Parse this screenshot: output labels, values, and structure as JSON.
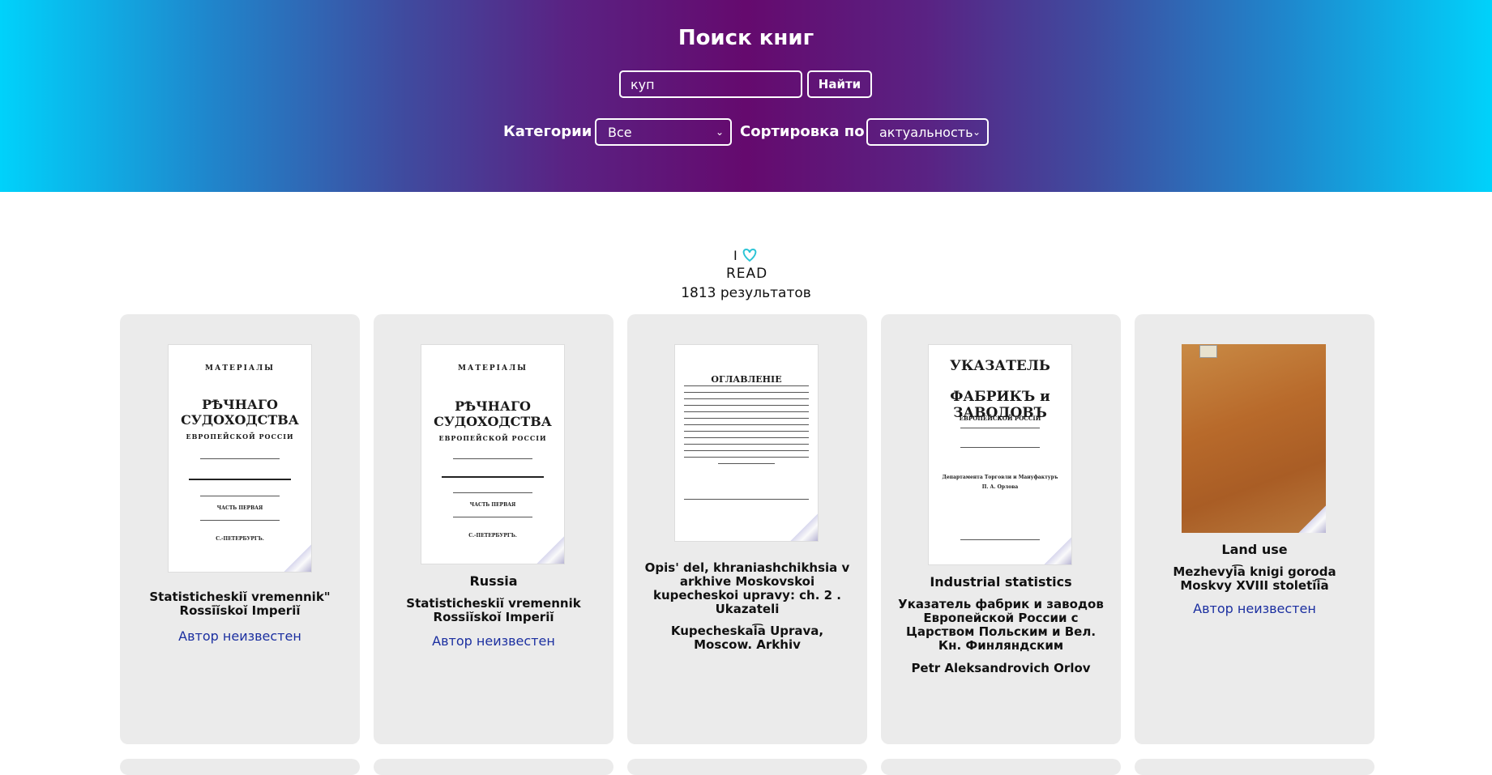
{
  "header": {
    "title": "Поиск книг",
    "search": {
      "value": "куп",
      "button_label": "Найти"
    },
    "filters": {
      "category_label": "Категории",
      "category_value": "Все",
      "sort_label": "Сортировка по",
      "sort_value": "актуальность"
    }
  },
  "logo": {
    "line1": "I",
    "line2": "READ",
    "heart_color": "#2bc4d6"
  },
  "results": {
    "count_text": "1813 результатов"
  },
  "books": [
    {
      "category": "",
      "title": "Statisticheskiĭ vremennik\" Rossīĭskoĭ Imperiĭ",
      "author": "Автор неизвестен",
      "author_is_link": true
    },
    {
      "category": "Russia",
      "title": "Statisticheskiĭ vremennik Rossiĭskoĭ Imperiĭ",
      "author": "Автор неизвестен",
      "author_is_link": true
    },
    {
      "category": "",
      "title": "Opis' del, khraniashchikhsia v arkhive Moskovskoi kupecheskoi upravy: ch. 2 . Ukazateli",
      "author": "Kupecheskai͡a Uprava, Moscow. Arkhiv",
      "author_is_link": false
    },
    {
      "category": "Industrial statistics",
      "title": "Указатель фабрик и заводов Европейской России с Царством Польским и Вел. Кн. Финляндским",
      "author": "Petr Aleksandrovich Orlov",
      "author_is_link": false
    },
    {
      "category": "Land use",
      "title": "Mezhevyi͡a knigi goroda Moskvy XVIII stoletīi͡a",
      "author": "Автор неизвестен",
      "author_is_link": true
    }
  ]
}
